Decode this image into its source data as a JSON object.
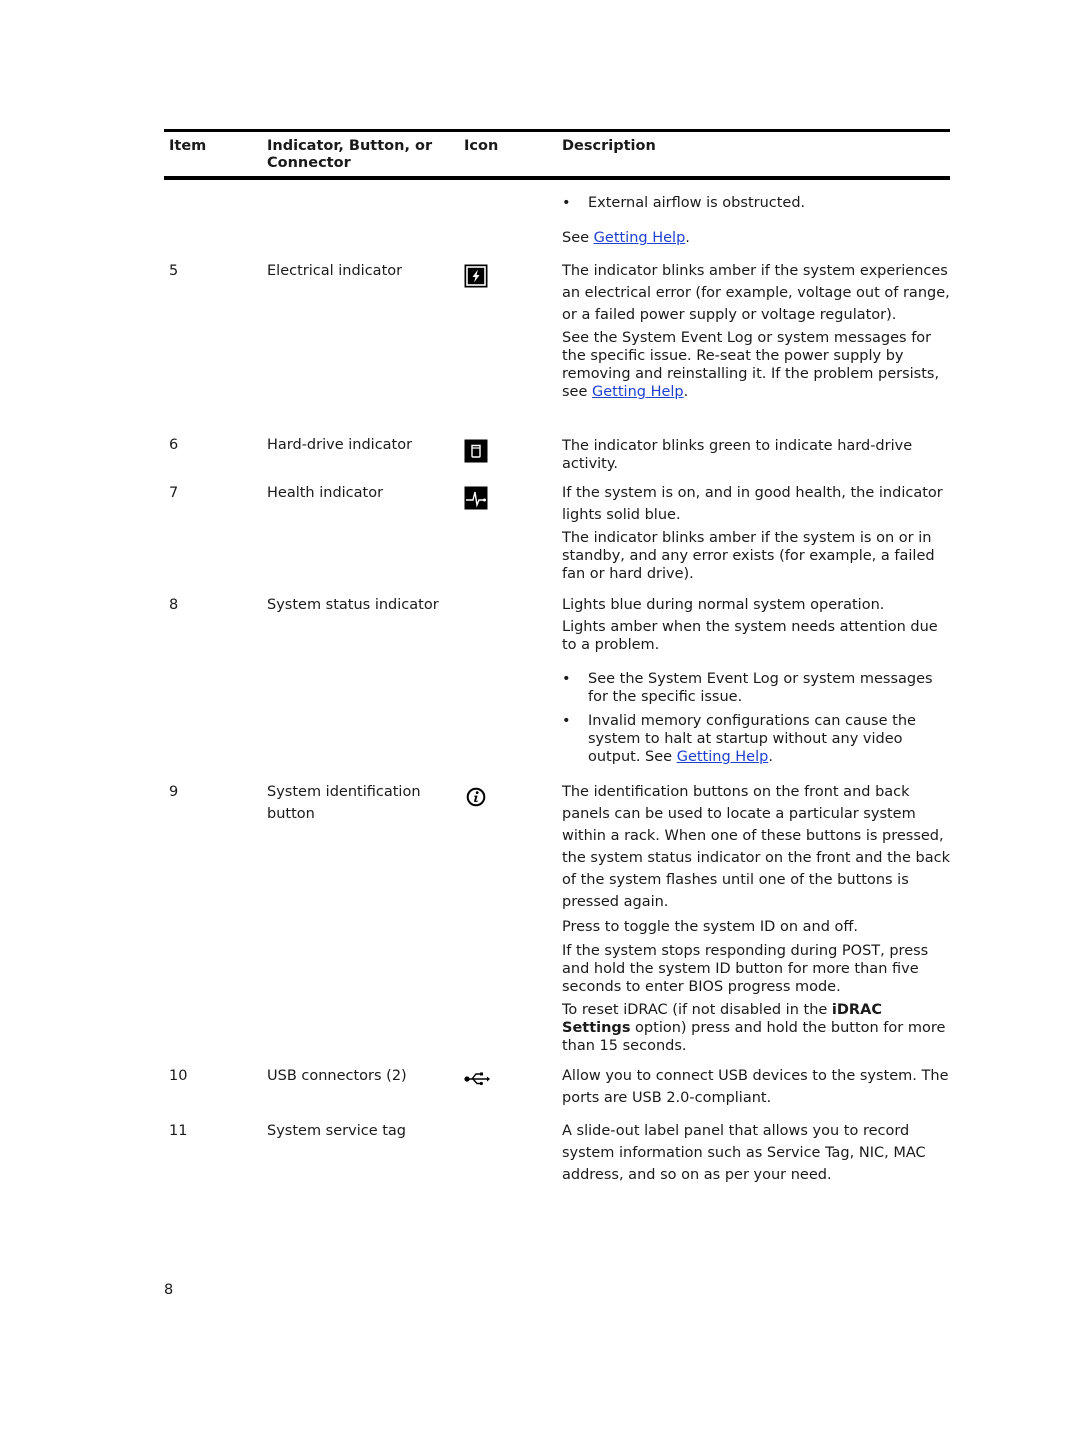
{
  "table": {
    "headers": {
      "item": "Item",
      "indicator": "Indicator, Button, or Connector",
      "icon": "Icon",
      "description": "Description"
    },
    "continued": {
      "bullet": "External airflow is obstructed.",
      "see_prefix": "See ",
      "link": "Getting Help",
      "see_suffix": "."
    },
    "rows": [
      {
        "item": "5",
        "name": "Electrical indicator",
        "icon": "electrical-indicator-icon",
        "p1": "The indicator blinks amber if the system experiences an electrical error (for example, voltage out of range, or a failed power supply or voltage regulator).",
        "p2": "See the System Event Log or system messages for the specific issue. Re-seat the power supply by removing and reinstalling it. If the problem persists, see ",
        "p2_link": "Getting Help",
        "p2_suffix": "."
      },
      {
        "item": "6",
        "name": "Hard-drive indicator",
        "icon": "hard-drive-indicator-icon",
        "p1": "The indicator blinks green to indicate hard-drive activity."
      },
      {
        "item": "7",
        "name": "Health indicator",
        "icon": "health-indicator-icon",
        "p1": "If the system is on, and in good health, the indicator lights solid blue.",
        "p2": "The indicator blinks amber if the system is on or in standby, and any error exists (for example, a failed fan or hard drive)."
      },
      {
        "item": "8",
        "name": "System status indicator",
        "p1": "Lights blue during normal system operation.",
        "p2": "Lights amber when the system needs attention due to a problem.",
        "bullets": [
          "See the System Event Log or system messages for the specific issue.",
          "Invalid memory configurations can cause the system to halt at startup without any video output. See "
        ],
        "bullet_link": "Getting Help",
        "bullet_suffix": "."
      },
      {
        "item": "9",
        "name": "System identification button",
        "icon": "system-id-icon",
        "p1": "The identification buttons on the front and back panels can be used to locate a particular system within a rack. When one of these buttons is pressed, the system status indicator on the front and the back of the system flashes until one of the buttons is pressed again.",
        "p2": "Press to toggle the system ID on and off.",
        "p3": "If the system stops responding during POST, press and hold the system ID button for more than five seconds to enter BIOS progress mode.",
        "p4_prefix": "To reset iDRAC (if not disabled in the ",
        "p4_bold": "iDRAC Settings",
        "p4_suffix": " option) press and hold the button for more than 15 seconds."
      },
      {
        "item": "10",
        "name": "USB connectors (2)",
        "icon": "usb-icon",
        "p1": "Allow you to connect USB devices to the system. The ports are USB 2.0-compliant."
      },
      {
        "item": "11",
        "name": "System service tag",
        "p1": "A slide-out label panel that allows you to record system information such as Service Tag, NIC, MAC address, and so on as per your need."
      }
    ]
  },
  "colors": {
    "link": "#1f3fcf",
    "rule": "#000000",
    "text": "#1a1a1a"
  },
  "page_number": "8"
}
